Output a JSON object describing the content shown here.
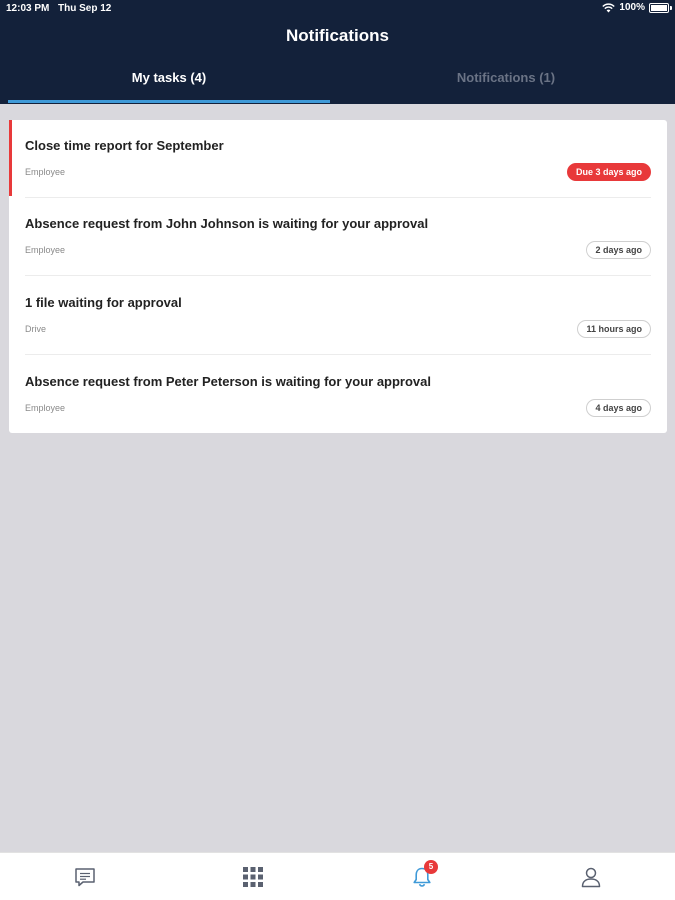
{
  "status_bar": {
    "time": "12:03 PM",
    "date": "Thu Sep 12",
    "battery": "100%"
  },
  "header": {
    "title": "Notifications"
  },
  "tabs": [
    {
      "label": "My tasks (4)",
      "active": true
    },
    {
      "label": "Notifications (1)",
      "active": false
    }
  ],
  "tasks": [
    {
      "title": "Close time report for September",
      "source": "Employee",
      "badge": "Due 3 days ago",
      "overdue": true
    },
    {
      "title": "Absence request from John Johnson is waiting for your approval",
      "source": "Employee",
      "badge": "2 days ago",
      "overdue": false
    },
    {
      "title": "1 file waiting for approval",
      "source": "Drive",
      "badge": "11 hours ago",
      "overdue": false
    },
    {
      "title": "Absence request from Peter Peterson is waiting for your approval",
      "source": "Employee",
      "badge": "4 days ago",
      "overdue": false
    }
  ],
  "bottom_nav": {
    "items": [
      {
        "icon": "chat-icon"
      },
      {
        "icon": "apps-grid-icon"
      },
      {
        "icon": "bell-icon",
        "badge": "5"
      },
      {
        "icon": "user-profile-icon"
      }
    ]
  },
  "colors": {
    "header_bg": "#13213a",
    "accent_tab": "#3f9ad8",
    "alert_red": "#e8393a",
    "active_nav": "#3f9ad8"
  }
}
